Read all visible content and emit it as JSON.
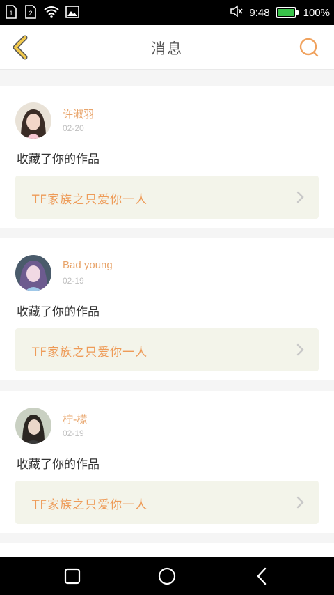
{
  "status_bar": {
    "sim1": "1",
    "sim2": "2",
    "time": "9:48",
    "battery_percent": "100%",
    "battery_level": 1.0,
    "icons": [
      "sim1-icon",
      "sim2-icon",
      "wifi-icon",
      "gallery-icon",
      "mute-icon",
      "battery-icon"
    ]
  },
  "header": {
    "title": "消息",
    "back_icon": "chevron-left-icon",
    "search_icon": "search-icon"
  },
  "messages": [
    {
      "user": "许淑羽",
      "date": "02-20",
      "action": "收藏了你的作品",
      "work_title": "TF家族之只爱你一人"
    },
    {
      "user": "Bad young",
      "date": "02-19",
      "action": "收藏了你的作品",
      "work_title": "TF家族之只爱你一人"
    },
    {
      "user": "柠-檬",
      "date": "02-19",
      "action": "收藏了你的作品",
      "work_title": "TF家族之只爱你一人"
    }
  ],
  "colors": {
    "accent": "#ee9b58",
    "username": "#e8a46a",
    "back_icon": "#f2c94c",
    "link_bg": "#f3f4ea"
  },
  "nav_bar": {
    "icons": [
      "recent-apps-icon",
      "home-icon",
      "back-icon"
    ]
  }
}
